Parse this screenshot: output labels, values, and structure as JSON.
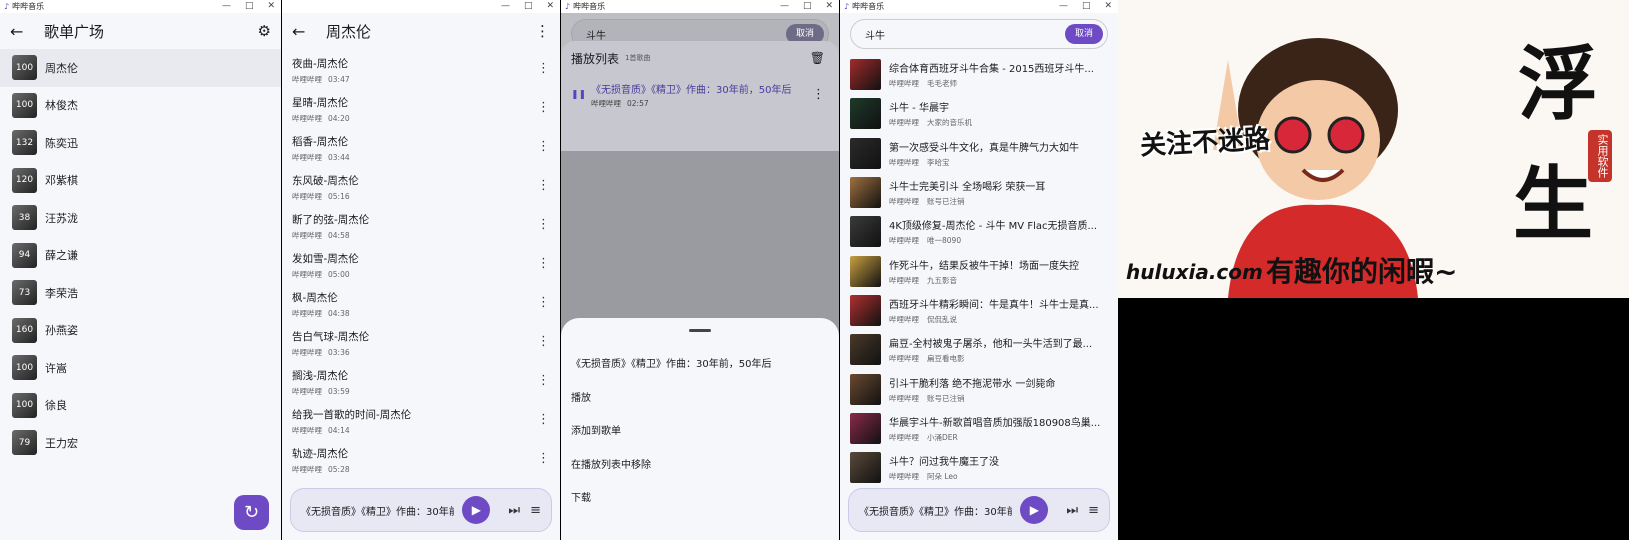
{
  "app": {
    "name": "哔哔音乐"
  },
  "window_controls": {
    "minimize": "—",
    "maximize": "□",
    "close": "✕"
  },
  "screen1": {
    "title": "歌单广场",
    "artists": [
      {
        "count": "100",
        "name": "周杰伦"
      },
      {
        "count": "100",
        "name": "林俊杰"
      },
      {
        "count": "132",
        "name": "陈奕迅"
      },
      {
        "count": "120",
        "name": "邓紫棋"
      },
      {
        "count": "38",
        "name": "汪苏泷"
      },
      {
        "count": "94",
        "name": "薛之谦"
      },
      {
        "count": "73",
        "name": "李荣浩"
      },
      {
        "count": "160",
        "name": "孙燕姿"
      },
      {
        "count": "100",
        "name": "许嵩"
      },
      {
        "count": "100",
        "name": "徐良"
      },
      {
        "count": "79",
        "name": "王力宏"
      }
    ]
  },
  "screen2": {
    "title": "周杰伦",
    "songs": [
      {
        "title": "夜曲-周杰伦",
        "source": "哔哩哔哩",
        "duration": "03:47"
      },
      {
        "title": "星晴-周杰伦",
        "source": "哔哩哔哩",
        "duration": "04:20"
      },
      {
        "title": "稻香-周杰伦",
        "source": "哔哩哔哩",
        "duration": "03:44"
      },
      {
        "title": "东风破-周杰伦",
        "source": "哔哩哔哩",
        "duration": "05:16"
      },
      {
        "title": "断了的弦-周杰伦",
        "source": "哔哩哔哩",
        "duration": "04:58"
      },
      {
        "title": "发如雪-周杰伦",
        "source": "哔哩哔哩",
        "duration": "05:00"
      },
      {
        "title": "枫-周杰伦",
        "source": "哔哩哔哩",
        "duration": "04:38"
      },
      {
        "title": "告白气球-周杰伦",
        "source": "哔哩哔哩",
        "duration": "03:36"
      },
      {
        "title": "搁浅-周杰伦",
        "source": "哔哩哔哩",
        "duration": "03:59"
      },
      {
        "title": "给我一首歌的时间-周杰伦",
        "source": "哔哩哔哩",
        "duration": "04:14"
      },
      {
        "title": "轨迹-周杰伦",
        "source": "哔哩哔哩",
        "duration": "05:28"
      }
    ]
  },
  "player": {
    "now_playing": "《无损音质》《精卫》作曲：30年前，50年后"
  },
  "screen3": {
    "search_value": "斗牛",
    "cancel": "取消",
    "playlist_title": "播放列表",
    "playlist_count": "1首歌曲",
    "item": {
      "title": "《无损音质》《精卫》作曲：30年前，50年后",
      "source": "哔哩哔哩",
      "duration": "02:57"
    },
    "menu_title": "《无损音质》《精卫》作曲：30年前，50年后",
    "menu": [
      "播放",
      "添加到歌单",
      "在播放列表中移除",
      "下载"
    ]
  },
  "screen4": {
    "search_value": "斗牛",
    "cancel": "取消",
    "results": [
      {
        "title": "综合体育西班牙斗牛合集 - 2015西班牙斗牛...",
        "source": "哔哩哔哩",
        "uploader": "毛毛老师"
      },
      {
        "title": "斗牛 - 华晨宇",
        "source": "哔哩哔哩",
        "uploader": "大家的音乐机"
      },
      {
        "title": "第一次感受斗牛文化，真是牛脾气力大如牛",
        "source": "哔哩哔哩",
        "uploader": "李哈宝"
      },
      {
        "title": "斗牛士完美引斗 全场喝彩 荣获一耳",
        "source": "哔哩哔哩",
        "uploader": "账号已注销"
      },
      {
        "title": "4K顶级修复-周杰伦 - 斗牛 MV Flac无损音质...",
        "source": "哔哩哔哩",
        "uploader": "唯一8090"
      },
      {
        "title": "作死斗牛，结果反被牛干掉！场面一度失控",
        "source": "哔哩哔哩",
        "uploader": "九五影音"
      },
      {
        "title": "西班牙斗牛精彩瞬间：牛是真牛！斗牛士是真...",
        "source": "哔哩哔哩",
        "uploader": "侃侃乱说"
      },
      {
        "title": "扁豆-全村被鬼子屠杀，他和一头牛活到了最...",
        "source": "哔哩哔哩",
        "uploader": "扁豆看电影"
      },
      {
        "title": "引斗干脆利落 绝不拖泥带水 一剑毙命",
        "source": "哔哩哔哩",
        "uploader": "账号已注销"
      },
      {
        "title": "华晨宇斗牛-新歌首唱音质加强版180908鸟巢...",
        "source": "哔哩哔哩",
        "uploader": "小涌DER"
      },
      {
        "title": "斗牛？问过我牛魔王了没",
        "source": "哔哩哔哩",
        "uploader": "阿朵 Leo"
      }
    ]
  },
  "promo": {
    "big1": "浮",
    "big2": "生",
    "seal": "实用软件",
    "slogan": "关注不迷路",
    "site": "huluxia.com",
    "tagline": "有趣你的闲暇~"
  }
}
